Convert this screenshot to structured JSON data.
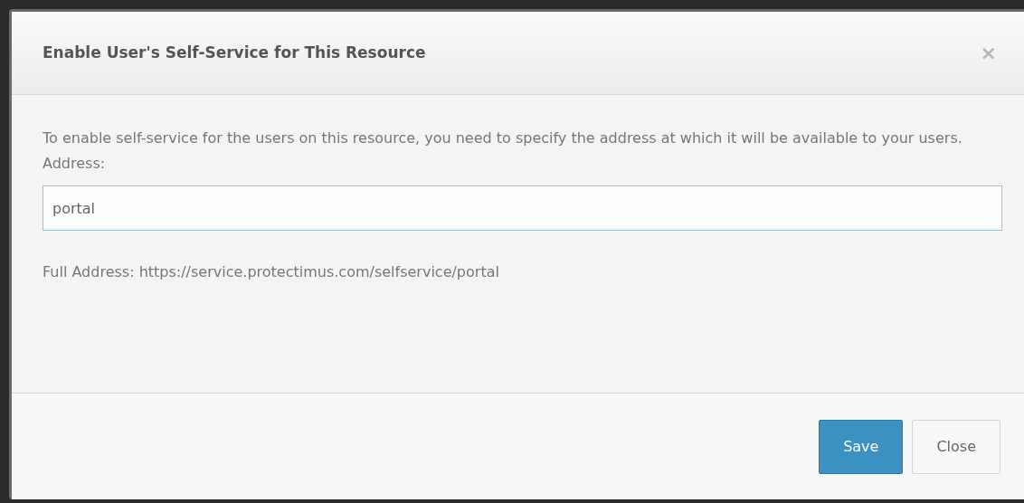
{
  "dialog": {
    "title": "Enable User's Self-Service for This Resource",
    "close_glyph": "×",
    "description": "To enable self-service for the users on this resource, you need to specify the address at which it will be available to your users.",
    "address_label": "Address:",
    "address_field": {
      "value": "portal"
    },
    "full_address": "Full Address: https://service.protectimus.com/selfservice/portal",
    "buttons": [
      {
        "label": "Save",
        "kind": "primary"
      },
      {
        "label": "Close",
        "kind": "default"
      }
    ]
  }
}
